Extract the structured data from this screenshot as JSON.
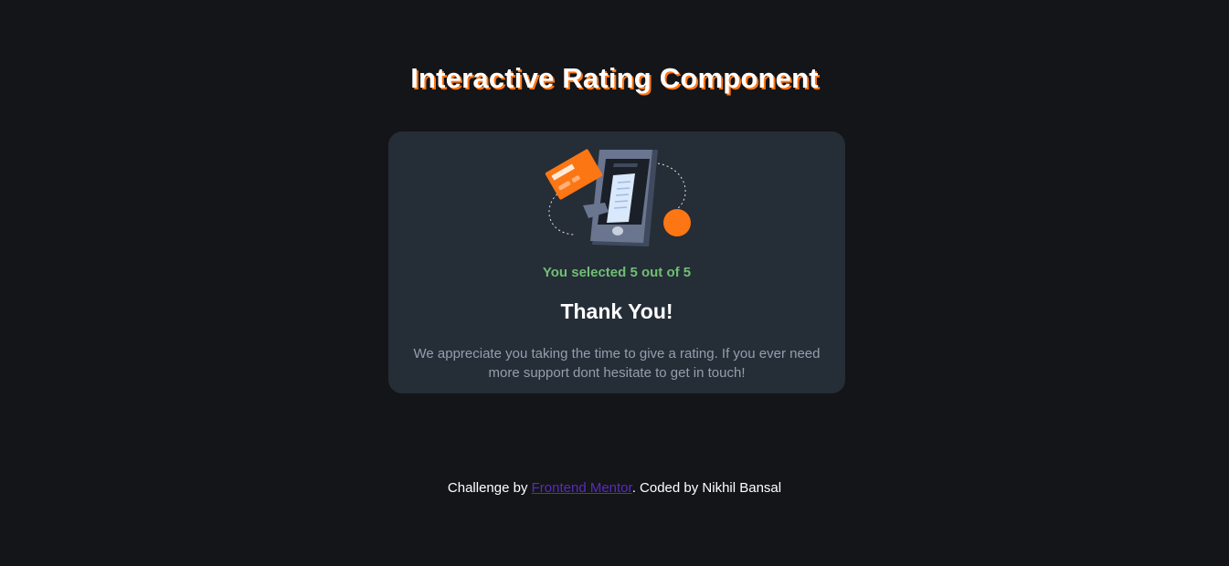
{
  "header": {
    "title": "Interactive Rating Component"
  },
  "card": {
    "illustration_icon": "payment-phone-illustration-icon",
    "selected_text": "You selected 5 out of 5",
    "selected_rating": 5,
    "max_rating": 5,
    "heading": "Thank You!",
    "message": "We appreciate you taking the time to give a rating. If you ever need more support dont hesitate to get in touch!"
  },
  "footer": {
    "prefix": "Challenge by ",
    "link_label": "Frontend Mentor",
    "suffix": ". Coded by Nikhil Bansal"
  },
  "colors": {
    "background": "#131518",
    "card": "#252d37",
    "accent": "#fc7614",
    "selected_text": "#6fbf73",
    "muted_text": "#959eac",
    "link": "#5b2bbd"
  }
}
